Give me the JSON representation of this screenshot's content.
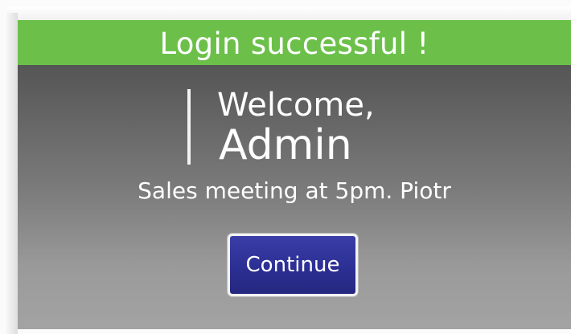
{
  "banner": {
    "text": "Login successful !",
    "color": "#6cc04a"
  },
  "welcome": {
    "greeting": "Welcome,",
    "user": "Admin"
  },
  "message": "Sales meeting at 5pm. Piotr",
  "actions": {
    "continue_label": "Continue",
    "button_color": "#2c2f93"
  }
}
